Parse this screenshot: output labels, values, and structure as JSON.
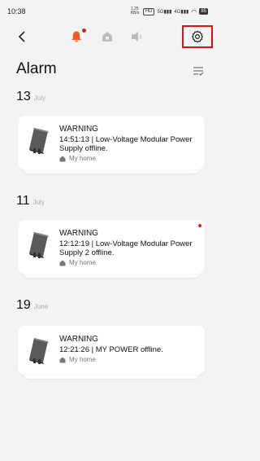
{
  "status_bar": {
    "time": "10:38",
    "net_speed": "1.25 KB/s",
    "hd": "HD",
    "net_5g": "5G",
    "net_4g": "4G",
    "battery": "85"
  },
  "header": {
    "title": "Alarm"
  },
  "groups": [
    {
      "day": "13",
      "month": "July",
      "items": [
        {
          "title": "WARNING",
          "message": "14:51:13 | Low-Voltage Modular Power Supply offline.",
          "location": "My home",
          "unread": false
        }
      ]
    },
    {
      "day": "11",
      "month": "July",
      "items": [
        {
          "title": "WARNING",
          "message": "12:12:19 | Low-Voltage Modular Power Supply 2  offline.",
          "location": "My home",
          "unread": true
        }
      ]
    },
    {
      "day": "19",
      "month": "June",
      "items": [
        {
          "title": "WARNING",
          "message": "12:21:26 | MY POWER offline.",
          "location": "My home",
          "unread": false
        }
      ]
    }
  ],
  "colors": {
    "accent": "#f15a22",
    "highlight_border": "#e01010",
    "unread_dot": "#e02020"
  }
}
